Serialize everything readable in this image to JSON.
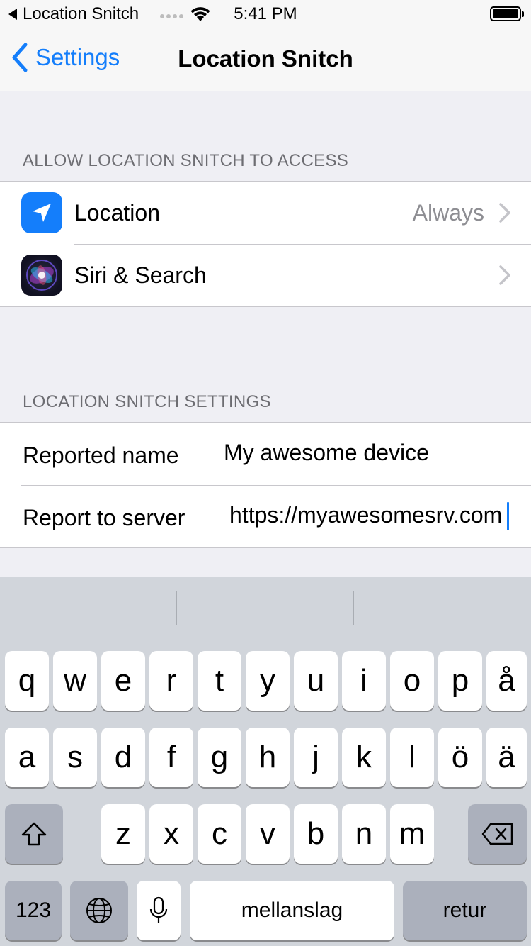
{
  "status_bar": {
    "back_app": "Location Snitch",
    "time": "5:41 PM"
  },
  "nav": {
    "back_label": "Settings",
    "title": "Location Snitch"
  },
  "sections": {
    "access_header": "ALLOW LOCATION SNITCH TO ACCESS",
    "settings_header": "LOCATION SNITCH SETTINGS"
  },
  "access_rows": [
    {
      "label": "Location",
      "value": "Always",
      "icon": "location-arrow-icon"
    },
    {
      "label": "Siri & Search",
      "value": "",
      "icon": "siri-icon"
    }
  ],
  "settings_fields": [
    {
      "label": "Reported name",
      "value": "My awesome device"
    },
    {
      "label": "Report to server",
      "value": "https://myawesomesrv.com"
    }
  ],
  "keyboard": {
    "row1": [
      "q",
      "w",
      "e",
      "r",
      "t",
      "y",
      "u",
      "i",
      "o",
      "p",
      "å"
    ],
    "row2": [
      "a",
      "s",
      "d",
      "f",
      "g",
      "h",
      "j",
      "k",
      "l",
      "ö",
      "ä"
    ],
    "row3": [
      "z",
      "x",
      "c",
      "v",
      "b",
      "n",
      "m"
    ],
    "numbers_label": "123",
    "space_label": "mellanslag",
    "return_label": "retur"
  },
  "colors": {
    "accent": "#147efb",
    "background": "#efeff4",
    "keyboard_bg": "#d1d5db"
  }
}
